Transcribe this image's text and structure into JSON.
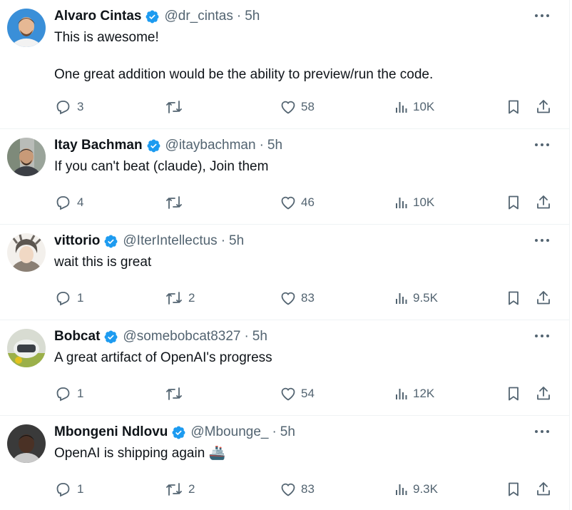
{
  "tweets": [
    {
      "name": "Alvaro Cintas",
      "handle": "@dr_cintas",
      "time": "5h",
      "text": "This is awesome!\n\nOne great addition would be the ability to preview/run the code.",
      "replies": "3",
      "retweets": "",
      "likes": "58",
      "views": "10K",
      "avatar": "avatar-alvaro"
    },
    {
      "name": "Itay Bachman",
      "handle": "@itaybachman",
      "time": "5h",
      "text": "If you can't beat (claude), Join them",
      "replies": "4",
      "retweets": "",
      "likes": "46",
      "views": "10K",
      "avatar": "avatar-itay"
    },
    {
      "name": "vittorio",
      "handle": "@IterIntellectus",
      "time": "5h",
      "text": "wait this is great",
      "replies": "1",
      "retweets": "2",
      "likes": "83",
      "views": "9.5K",
      "avatar": "avatar-vittorio"
    },
    {
      "name": "Bobcat",
      "handle": "@somebobcat8327",
      "time": "5h",
      "text": "A great artifact of OpenAI's progress",
      "replies": "1",
      "retweets": "",
      "likes": "54",
      "views": "12K",
      "avatar": "avatar-bobcat"
    },
    {
      "name": "Mbongeni Ndlovu",
      "handle": "@Mbounge_",
      "time": "5h",
      "text": "OpenAI is shipping again 🚢",
      "replies": "1",
      "retweets": "2",
      "likes": "83",
      "views": "9.3K",
      "avatar": "avatar-mbongeni"
    }
  ],
  "separator": "·",
  "colors": {
    "verified": "#1d9bf0",
    "muted": "#536471",
    "text": "#0f1419",
    "divider": "#eff3f4"
  },
  "icons": [
    "verified-badge-icon",
    "more-icon",
    "reply-icon",
    "retweet-icon",
    "like-icon",
    "views-icon",
    "bookmark-icon",
    "share-icon"
  ]
}
